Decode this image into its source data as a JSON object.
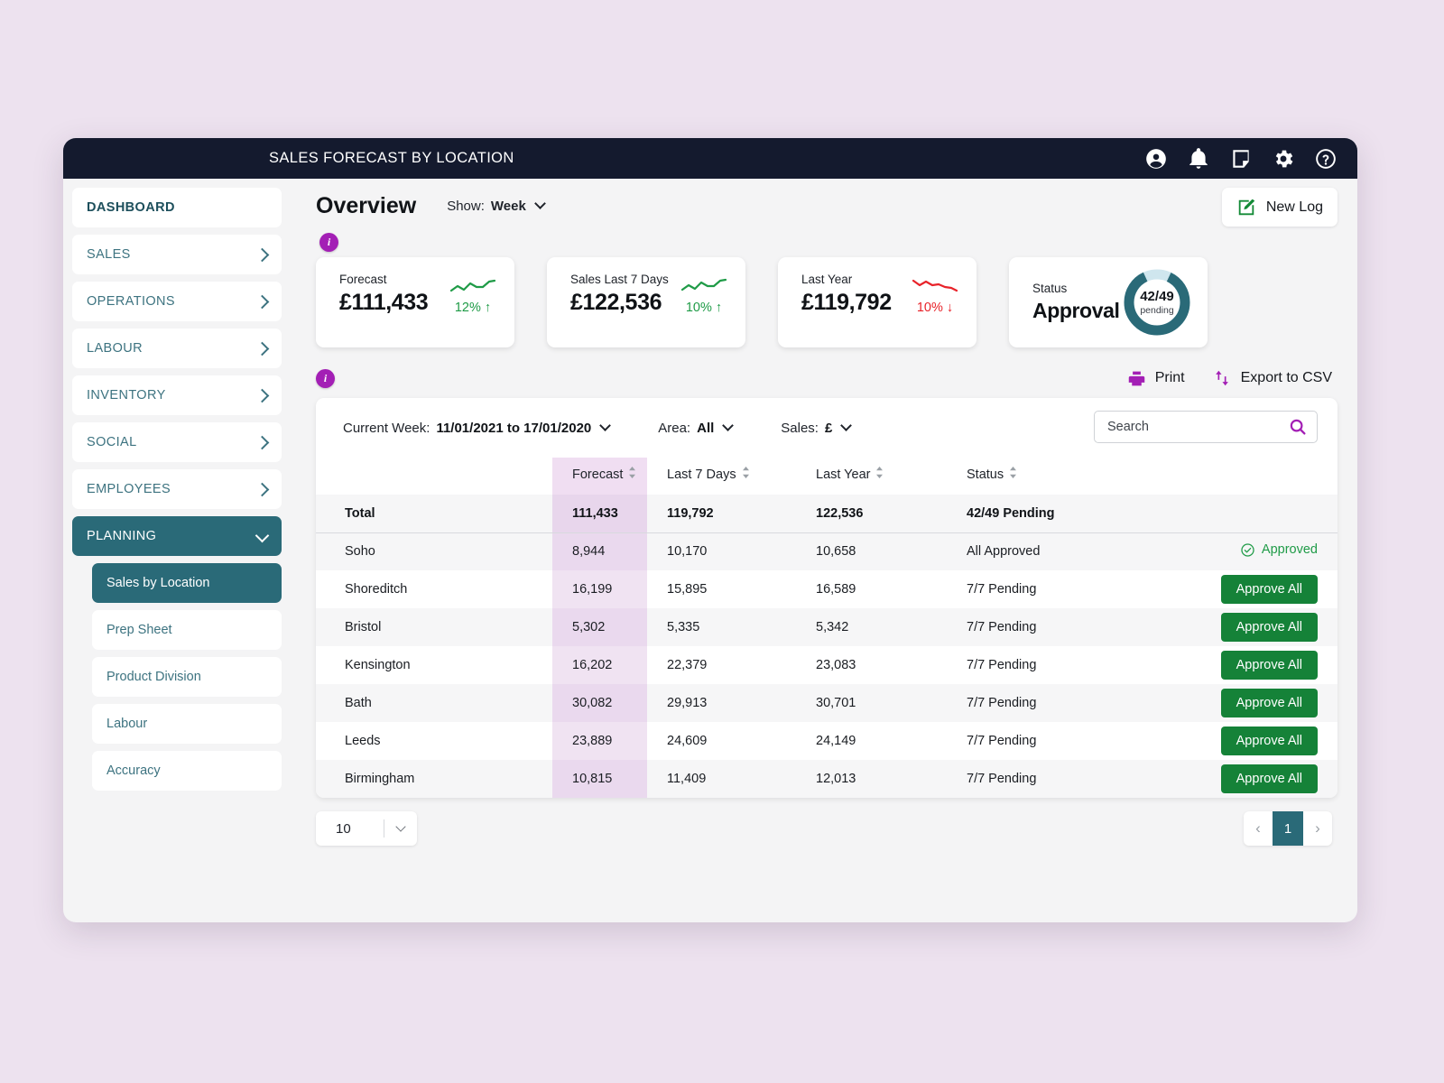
{
  "topbar": {
    "title": "SALES FORECAST BY LOCATION",
    "icons": [
      "account-icon",
      "bell-icon",
      "note-icon",
      "gear-icon",
      "help-icon"
    ]
  },
  "sidebar": {
    "items": [
      {
        "label": "DASHBOARD",
        "expandable": false,
        "active": false
      },
      {
        "label": "SALES",
        "expandable": true,
        "active": false
      },
      {
        "label": "OPERATIONS",
        "expandable": true,
        "active": false
      },
      {
        "label": "LABOUR",
        "expandable": true,
        "active": false
      },
      {
        "label": "INVENTORY",
        "expandable": true,
        "active": false
      },
      {
        "label": "SOCIAL",
        "expandable": true,
        "active": false
      },
      {
        "label": "EMPLOYEES",
        "expandable": true,
        "active": false
      },
      {
        "label": "PLANNING",
        "expandable": true,
        "active": true
      }
    ],
    "submenu": [
      {
        "label": "Sales by Location",
        "active": true
      },
      {
        "label": "Prep Sheet",
        "active": false
      },
      {
        "label": "Product Division",
        "active": false
      },
      {
        "label": "Labour",
        "active": false
      },
      {
        "label": "Accuracy",
        "active": false
      }
    ]
  },
  "page": {
    "title": "Overview",
    "show_label": "Show:",
    "show_value": "Week",
    "new_log_label": "New Log",
    "info_badge": "i"
  },
  "kpis": [
    {
      "label": "Forecast",
      "value": "£111,433",
      "pct": "12%",
      "direction": "up"
    },
    {
      "label": "Sales Last 7 Days",
      "value": "£122,536",
      "pct": "10%",
      "direction": "up"
    },
    {
      "label": "Last Year",
      "value": "£119,792",
      "pct": "10%",
      "direction": "down"
    }
  ],
  "status_card": {
    "label": "Status",
    "value": "Approval",
    "donut_value": "42/49",
    "donut_sub": "pending",
    "donut_pct": 86
  },
  "tools": {
    "print_label": "Print",
    "export_label": "Export to CSV"
  },
  "filters": {
    "week_label": "Current Week:",
    "week_value": "11/01/2021 to 17/01/2020",
    "area_label": "Area:",
    "area_value": "All",
    "sales_label": "Sales:",
    "sales_value": "£",
    "search_placeholder": "Search",
    "search_value": ""
  },
  "table": {
    "columns": [
      "",
      "Forecast",
      "Last 7 Days",
      "Last Year",
      "Status",
      ""
    ],
    "total_row": {
      "name": "Total",
      "forecast": "111,433",
      "last7": "119,792",
      "lastyear": "122,536",
      "status": "42/49 Pending"
    },
    "rows": [
      {
        "name": "Soho",
        "forecast": "8,944",
        "last7": "10,170",
        "lastyear": "10,658",
        "status": "All Approved",
        "action": "Approved",
        "action_type": "approved"
      },
      {
        "name": "Shoreditch",
        "forecast": "16,199",
        "last7": "15,895",
        "lastyear": "16,589",
        "status": "7/7 Pending",
        "action": "Approve All",
        "action_type": "button"
      },
      {
        "name": "Bristol",
        "forecast": "5,302",
        "last7": "5,335",
        "lastyear": "5,342",
        "status": "7/7 Pending",
        "action": "Approve All",
        "action_type": "button"
      },
      {
        "name": "Kensington",
        "forecast": "16,202",
        "last7": "22,379",
        "lastyear": "23,083",
        "status": "7/7 Pending",
        "action": "Approve All",
        "action_type": "button"
      },
      {
        "name": "Bath",
        "forecast": "30,082",
        "last7": "29,913",
        "lastyear": "30,701",
        "status": "7/7 Pending",
        "action": "Approve All",
        "action_type": "button"
      },
      {
        "name": "Leeds",
        "forecast": "23,889",
        "last7": "24,609",
        "lastyear": "24,149",
        "status": "7/7 Pending",
        "action": "Approve All",
        "action_type": "button"
      },
      {
        "name": "Birmingham",
        "forecast": "10,815",
        "last7": "11,409",
        "lastyear": "12,013",
        "status": "7/7 Pending",
        "action": "Approve All",
        "action_type": "button"
      }
    ]
  },
  "footer": {
    "per_page": "10",
    "current_page": "1",
    "prev": "‹",
    "next": "›"
  },
  "colors": {
    "topbar": "#141a2e",
    "accent_teal": "#2a6a78",
    "accent_purple": "#a31fb5",
    "approve_green": "#158238",
    "up_green": "#1f9b47",
    "down_red": "#e8232a",
    "forecast_tint": "#f0e3f2",
    "page_bg": "#ede2ef"
  }
}
